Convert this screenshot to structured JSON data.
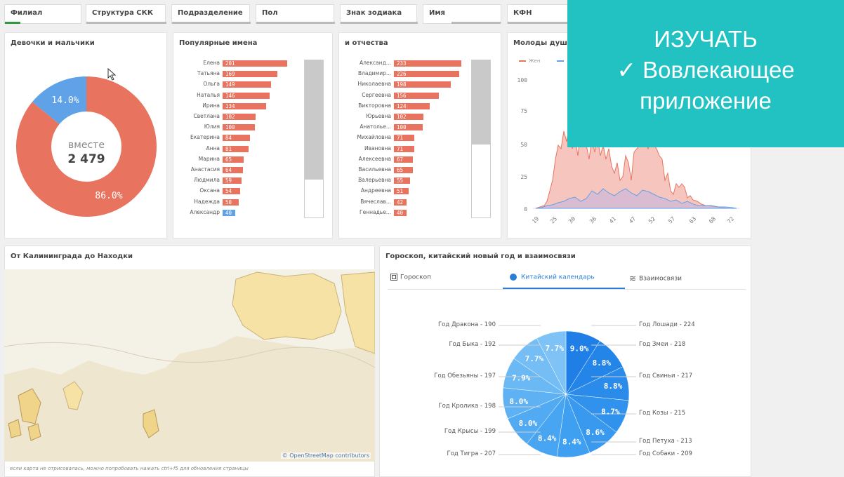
{
  "filters": [
    "Филиал",
    "Структура СКК",
    "Подразделение",
    "Пол",
    "Знак зодиака",
    "Имя",
    "КФН"
  ],
  "overlay": {
    "line1": "ИЗУЧАТЬ",
    "line2": "✓ Вовлекающее",
    "line3": "приложение"
  },
  "donut": {
    "title": "Девочки и мальчики",
    "center_label": "вместе",
    "center_value": "2 479",
    "slices": [
      {
        "label": "14.0%",
        "value": 14.0,
        "color": "#5fa2e8"
      },
      {
        "label": "86.0%",
        "value": 86.0,
        "color": "#e8735f"
      }
    ]
  },
  "popular_names": {
    "title": "Популярные имена",
    "items": [
      {
        "name": "Елена",
        "value": 201
      },
      {
        "name": "Татьяна",
        "value": 169
      },
      {
        "name": "Ольга",
        "value": 149
      },
      {
        "name": "Наталья",
        "value": 146
      },
      {
        "name": "Ирина",
        "value": 134
      },
      {
        "name": "Светлана",
        "value": 102
      },
      {
        "name": "Юлия",
        "value": 100
      },
      {
        "name": "Екатерина",
        "value": 84
      },
      {
        "name": "Анна",
        "value": 81
      },
      {
        "name": "Марина",
        "value": 65
      },
      {
        "name": "Анастасия",
        "value": 64
      },
      {
        "name": "Людмила",
        "value": 59
      },
      {
        "name": "Оксана",
        "value": 54
      },
      {
        "name": "Надежда",
        "value": 50
      },
      {
        "name": "Александр",
        "value": 40,
        "blue": true
      }
    ]
  },
  "patronymics": {
    "title": "и отчества",
    "items": [
      {
        "name": "Александ...",
        "value": 233
      },
      {
        "name": "Владимир...",
        "value": 226
      },
      {
        "name": "Николаевна",
        "value": 198
      },
      {
        "name": "Сергеевна",
        "value": 156
      },
      {
        "name": "Викторовна",
        "value": 124
      },
      {
        "name": "Юрьевна",
        "value": 102
      },
      {
        "name": "Анатолье...",
        "value": 100
      },
      {
        "name": "Михайловна",
        "value": 71
      },
      {
        "name": "Ивановна",
        "value": 71
      },
      {
        "name": "Алексеевна",
        "value": 67
      },
      {
        "name": "Васильевна",
        "value": 65
      },
      {
        "name": "Валерьевна",
        "value": 55
      },
      {
        "name": "Андреевна",
        "value": 51
      },
      {
        "name": "Вячеслав...",
        "value": 42
      },
      {
        "name": "Геннадье...",
        "value": 40
      }
    ]
  },
  "age_chart": {
    "title": "Молоды душо",
    "legend": [
      "Жен",
      ""
    ],
    "y_ticks": [
      "100",
      "75",
      "50",
      "25",
      "0"
    ],
    "x_ticks": [
      "19",
      "25",
      "30",
      "36",
      "41",
      "47",
      "52",
      "57",
      "63",
      "68",
      "72"
    ]
  },
  "map": {
    "title": "От Калининграда до Находки",
    "attribution": "© OpenStreetMap contributors",
    "footnote": "если карта не отрисовалась, можно попробовать нажать ctrl+f5 для обновления страницы"
  },
  "horoscope": {
    "title": "Гороскоп, китайский новый год и взаимосвязи",
    "tabs": [
      {
        "label": "Гороскоп",
        "active": false
      },
      {
        "label": "Китайский календарь",
        "active": true
      },
      {
        "label": "Взаимосвязи",
        "active": false
      }
    ],
    "labels_left": [
      "Год Дракона - 190",
      "Год Быка - 192",
      "Год Обезьяны - 197",
      "Год Кролика - 198",
      "Год Крысы - 199",
      "Год Тигра - 207"
    ],
    "labels_right": [
      "Год Лошади - 224",
      "Год Змеи - 218",
      "Год Свиньи - 217",
      "Год Козы - 215",
      "Год Петуха - 213",
      "Год Собаки - 209"
    ],
    "pct_labels": [
      "9.0%",
      "8.8%",
      "8.8%",
      "8.7%",
      "8.6%",
      "8.4%",
      "8.4%",
      "8.0%",
      "8.0%",
      "7.9%",
      "7.7%",
      "7.7%"
    ]
  },
  "chart_data": [
    {
      "type": "pie",
      "title": "Девочки и мальчики",
      "categories": [
        "",
        ""
      ],
      "values": [
        14.0,
        86.0
      ]
    },
    {
      "type": "bar",
      "title": "Популярные имена",
      "categories": [
        "Елена",
        "Татьяна",
        "Ольга",
        "Наталья",
        "Ирина",
        "Светлана",
        "Юлия",
        "Екатерина",
        "Анна",
        "Марина",
        "Анастасия",
        "Людмила",
        "Оксана",
        "Надежда",
        "Александр"
      ],
      "values": [
        201,
        169,
        149,
        146,
        134,
        102,
        100,
        84,
        81,
        65,
        64,
        59,
        54,
        50,
        40
      ]
    },
    {
      "type": "bar",
      "title": "и отчества",
      "categories": [
        "Александ...",
        "Владимир...",
        "Николаевна",
        "Сергеевна",
        "Викторовна",
        "Юрьевна",
        "Анатолье...",
        "Михайловна",
        "Ивановна",
        "Алексеевна",
        "Васильевна",
        "Валерьевна",
        "Андреевна",
        "Вячеслав...",
        "Геннадье..."
      ],
      "values": [
        233,
        226,
        198,
        156,
        124,
        102,
        100,
        71,
        71,
        67,
        65,
        55,
        51,
        42,
        40
      ]
    },
    {
      "type": "pie",
      "title": "Гороскоп, китайский новый год и взаимосвязи",
      "categories": [
        "Год Лошади",
        "Год Змеи",
        "Год Свиньи",
        "Год Козы",
        "Год Петуха",
        "Год Собаки",
        "Год Тигра",
        "Год Крысы",
        "Год Кролика",
        "Год Обезьяны",
        "Год Быка",
        "Год Дракона"
      ],
      "values": [
        224,
        218,
        217,
        215,
        213,
        209,
        207,
        199,
        198,
        197,
        192,
        190
      ]
    }
  ]
}
